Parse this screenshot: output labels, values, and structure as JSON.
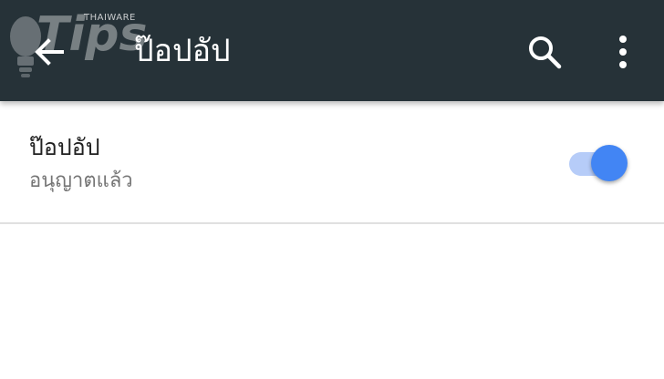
{
  "appbar": {
    "title": "ป๊อปอัป",
    "back_icon": "arrow-back-icon",
    "search_icon": "search-icon",
    "more_icon": "more-vert-icon",
    "background_color": "#263238"
  },
  "watermark": {
    "text": "Tips",
    "brand": "THAIWARE"
  },
  "setting": {
    "title": "ป๊อปอัป",
    "summary": "อนุญาตแล้ว",
    "toggle_on": true,
    "accent_color": "#4285f4"
  }
}
